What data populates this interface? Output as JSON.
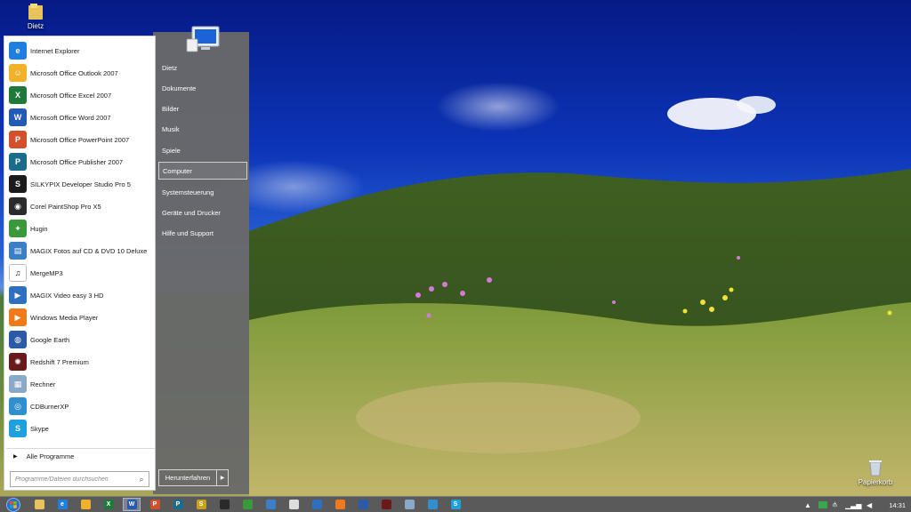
{
  "desktop": {
    "icons": [
      {
        "label": "Dietz",
        "icon": "folder-icon"
      },
      {
        "label": "Papierkorb",
        "icon": "recycle-bin-icon"
      }
    ]
  },
  "start_menu": {
    "programs": [
      {
        "label": "Internet Explorer",
        "icon": "internet-explorer-icon",
        "color": "#1f7fe0",
        "glyph": "e"
      },
      {
        "label": "Microsoft Office Outlook 2007",
        "icon": "outlook-icon",
        "color": "#f2b12a",
        "glyph": "☺"
      },
      {
        "label": "Microsoft Office Excel 2007",
        "icon": "excel-icon",
        "color": "#1f7a3a",
        "glyph": "X"
      },
      {
        "label": "Microsoft Office Word 2007",
        "icon": "word-icon",
        "color": "#2559b8",
        "glyph": "W"
      },
      {
        "label": "Microsoft Office PowerPoint 2007",
        "icon": "powerpoint-icon",
        "color": "#d2502b",
        "glyph": "P"
      },
      {
        "label": "Microsoft Office Publisher 2007",
        "icon": "publisher-icon",
        "color": "#1a6d8a",
        "glyph": "P"
      },
      {
        "label": "SILKYPIX Developer Studio Pro 5",
        "icon": "silkypix-icon",
        "color": "#1b1b1b",
        "glyph": "S"
      },
      {
        "label": "Corel PaintShop Pro X5",
        "icon": "paintshop-icon",
        "color": "#2a2a2a",
        "glyph": "◉"
      },
      {
        "label": "Hugin",
        "icon": "hugin-icon",
        "color": "#3a9a3a",
        "glyph": "✦"
      },
      {
        "label": "MAGIX Fotos auf CD & DVD 10 Deluxe",
        "icon": "magix-fotos-icon",
        "color": "#3b7fc4",
        "glyph": "▤"
      },
      {
        "label": "MergeMP3",
        "icon": "mergemp3-icon",
        "color": "#ffffff",
        "glyph": "♫"
      },
      {
        "label": "MAGIX Video easy 3 HD",
        "icon": "magix-video-icon",
        "color": "#2e6fbf",
        "glyph": "▶"
      },
      {
        "label": "Windows Media Player",
        "icon": "media-player-icon",
        "color": "#f07a1a",
        "glyph": "▶"
      },
      {
        "label": "Google Earth",
        "icon": "google-earth-icon",
        "color": "#2a5aa8",
        "glyph": "◍"
      },
      {
        "label": "Redshift 7 Premium",
        "icon": "redshift-icon",
        "color": "#6a1a1a",
        "glyph": "✺"
      },
      {
        "label": "Rechner",
        "icon": "calculator-icon",
        "color": "#8aa8c8",
        "glyph": "▦"
      },
      {
        "label": "CDBurnerXP",
        "icon": "cdburner-icon",
        "color": "#2f8fd0",
        "glyph": "◎"
      },
      {
        "label": "Skype",
        "icon": "skype-icon",
        "color": "#1ea0e0",
        "glyph": "S"
      }
    ],
    "all_programs_label": "Alle Programme",
    "search_placeholder": "Programme/Dateien durchsuchen",
    "right_items": [
      {
        "label": "Dietz"
      },
      {
        "label": "Dokumente"
      },
      {
        "label": "Bilder"
      },
      {
        "label": "Musik"
      },
      {
        "label": "Spiele"
      },
      {
        "label": "Computer",
        "selected": true
      },
      {
        "label": "Systemsteuerung"
      },
      {
        "label": "Geräte und Drucker"
      },
      {
        "label": "Hilfe und Support"
      }
    ],
    "shutdown_label": "Herunterfahren"
  },
  "taskbar": {
    "apps": [
      {
        "icon": "explorer-icon",
        "color": "#e8c35a",
        "glyph": ""
      },
      {
        "icon": "internet-explorer-icon",
        "color": "#1f7fe0",
        "glyph": "e"
      },
      {
        "icon": "outlook-icon",
        "color": "#f2b12a",
        "glyph": ""
      },
      {
        "icon": "excel-icon",
        "color": "#1f7a3a",
        "glyph": "X"
      },
      {
        "icon": "word-icon",
        "color": "#2559b8",
        "glyph": "W",
        "active": true
      },
      {
        "icon": "powerpoint-icon",
        "color": "#d2502b",
        "glyph": "P"
      },
      {
        "icon": "publisher-icon",
        "color": "#1a6d8a",
        "glyph": "P"
      },
      {
        "icon": "silkypix-icon",
        "color": "#c9a21a",
        "glyph": "S"
      },
      {
        "icon": "paintshop-icon",
        "color": "#2a2a2a",
        "glyph": ""
      },
      {
        "icon": "hugin-icon",
        "color": "#3a9a3a",
        "glyph": ""
      },
      {
        "icon": "magix-fotos-icon",
        "color": "#3b7fc4",
        "glyph": ""
      },
      {
        "icon": "mergemp3-icon",
        "color": "#dddddd",
        "glyph": ""
      },
      {
        "icon": "magix-video-icon",
        "color": "#2e6fbf",
        "glyph": ""
      },
      {
        "icon": "media-player-icon",
        "color": "#f07a1a",
        "glyph": ""
      },
      {
        "icon": "google-earth-icon",
        "color": "#2a5aa8",
        "glyph": ""
      },
      {
        "icon": "redshift-icon",
        "color": "#6a1a1a",
        "glyph": ""
      },
      {
        "icon": "calculator-icon",
        "color": "#8aa8c8",
        "glyph": ""
      },
      {
        "icon": "cdburner-icon",
        "color": "#2f8fd0",
        "glyph": ""
      },
      {
        "icon": "skype-icon",
        "color": "#1ea0e0",
        "glyph": "S"
      }
    ],
    "clock": "14:31"
  }
}
